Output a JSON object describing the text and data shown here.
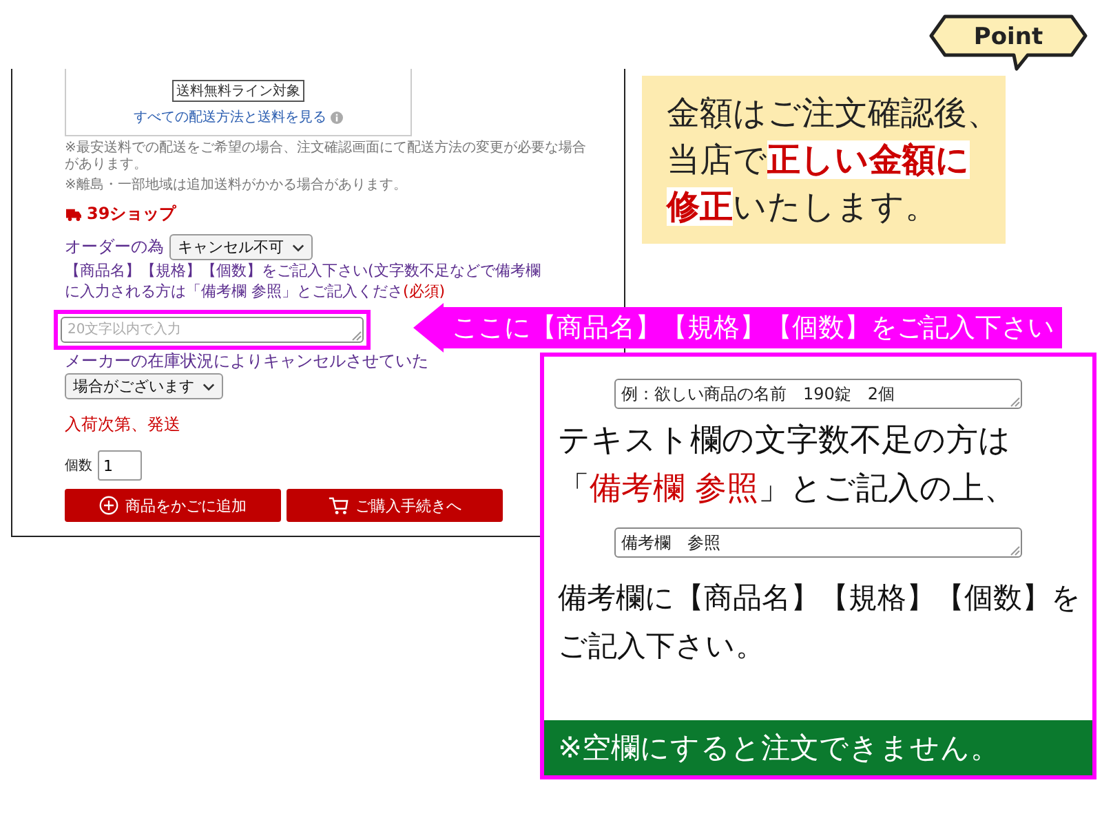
{
  "product_panel": {
    "shipping_box": {
      "tag": "送料無料ライン対象",
      "link": "すべての配送方法と送料を見る"
    },
    "notes": [
      "※最安送料での配送をご希望の場合、注文確認画面にて配送方法の変更が必要な場合があります。",
      "※離島・一部地域は追加送料がかかる場合があります。"
    ],
    "shop_name": "39ショップ",
    "order_row": {
      "label": "オーダーの為",
      "select_value": "キャンセル不可"
    },
    "instruction": [
      "【商品名】【規格】【個数】をご記入下さい(文字数不足などで備考欄",
      "に入力される方は「備考欄 参照」とご記入くださ"
    ],
    "required": "(必須)",
    "field": {
      "placeholder": "20文字以内で入力"
    },
    "stock_note": "メーカーの在庫状況によりキャンセルさせていた",
    "stock_select_value": "場合がございます",
    "shipping_status": "入荷次第、発送",
    "quantity": {
      "label": "個数",
      "value": "1"
    },
    "buttons": [
      {
        "label": "商品をかごに追加",
        "kind": "add"
      },
      {
        "label": "ご購入手続きへ",
        "kind": "checkout"
      }
    ]
  },
  "point_badge": "Point",
  "notice": [
    "金額はご注文確認後、",
    "当店で**正しい金額に**",
    "**修正**いたします。"
  ],
  "callout": "ここに【商品名】【規格】【個数】をご記入下さい",
  "instructions": {
    "example_field": {
      "value": "例：欲しい商品の名前　190錠　2個"
    },
    "text_1": [
      "テキスト欄の文字数不足の方は",
      "「**備考欄 参照**」とご記入の上、"
    ],
    "reference_field": {
      "value": "備考欄　参照"
    },
    "text_2": [
      "備考欄に【商品名】【規格】【個数】を",
      "ご記入下さい。"
    ],
    "warning": "※空欄にすると注文できません。"
  }
}
